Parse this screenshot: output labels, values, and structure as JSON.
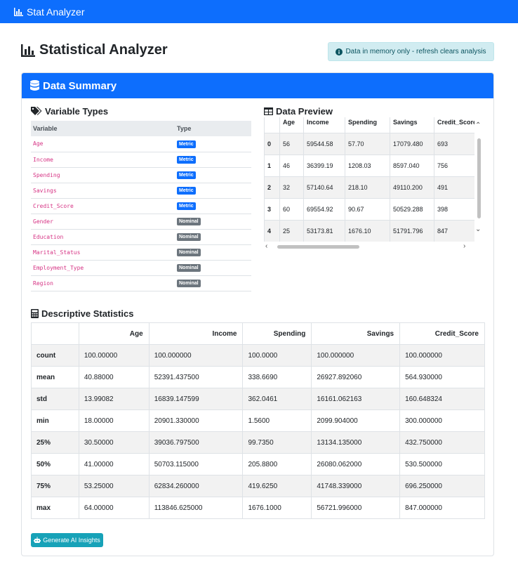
{
  "navbar": {
    "brand": "Stat Analyzer"
  },
  "header": {
    "title": "Statistical Analyzer",
    "alert": "Data in memory only - refresh clears analysis"
  },
  "card": {
    "title": "Data Summary"
  },
  "variable_types": {
    "title": "Variable Types",
    "headers": [
      "Variable",
      "Type"
    ],
    "rows": [
      {
        "name": "Age",
        "type": "Metric"
      },
      {
        "name": "Income",
        "type": "Metric"
      },
      {
        "name": "Spending",
        "type": "Metric"
      },
      {
        "name": "Savings",
        "type": "Metric"
      },
      {
        "name": "Credit_Score",
        "type": "Metric"
      },
      {
        "name": "Gender",
        "type": "Nominal"
      },
      {
        "name": "Education",
        "type": "Nominal"
      },
      {
        "name": "Marital_Status",
        "type": "Nominal"
      },
      {
        "name": "Employment_Type",
        "type": "Nominal"
      },
      {
        "name": "Region",
        "type": "Nominal"
      }
    ],
    "colors": {
      "Metric": "#0d6efd",
      "Nominal": "#6c757d"
    }
  },
  "data_preview": {
    "title": "Data Preview",
    "headers": [
      "",
      "Age",
      "Income",
      "Spending",
      "Savings",
      "Credit_Score"
    ],
    "rows": [
      [
        "0",
        "56",
        "59544.58",
        "57.70",
        "17079.480",
        "693"
      ],
      [
        "1",
        "46",
        "36399.19",
        "1208.03",
        "8597.040",
        "756"
      ],
      [
        "2",
        "32",
        "57140.64",
        "218.10",
        "49110.200",
        "491"
      ],
      [
        "3",
        "60",
        "69554.92",
        "90.67",
        "50529.288",
        "398"
      ],
      [
        "4",
        "25",
        "53173.81",
        "1676.10",
        "51791.796",
        "847"
      ]
    ]
  },
  "descriptive_stats": {
    "title": "Descriptive Statistics",
    "headers": [
      "",
      "Age",
      "Income",
      "Spending",
      "Savings",
      "Credit_Score"
    ],
    "rows": [
      [
        "count",
        "100.00000",
        "100.000000",
        "100.0000",
        "100.000000",
        "100.000000"
      ],
      [
        "mean",
        "40.88000",
        "52391.437500",
        "338.6690",
        "26927.892060",
        "564.930000"
      ],
      [
        "std",
        "13.99082",
        "16839.147599",
        "362.0461",
        "16161.062163",
        "160.648324"
      ],
      [
        "min",
        "18.00000",
        "20901.330000",
        "1.5600",
        "2099.904000",
        "300.000000"
      ],
      [
        "25%",
        "30.50000",
        "39036.797500",
        "99.7350",
        "13134.135000",
        "432.750000"
      ],
      [
        "50%",
        "41.00000",
        "50703.115000",
        "205.8800",
        "26080.062000",
        "530.500000"
      ],
      [
        "75%",
        "53.25000",
        "62834.260000",
        "419.6250",
        "41748.339000",
        "696.250000"
      ],
      [
        "max",
        "64.00000",
        "113846.625000",
        "1676.1000",
        "56721.996000",
        "847.000000"
      ]
    ]
  },
  "ai_button": {
    "label": "Generate AI Insights"
  },
  "colors": {
    "primary": "#0d6efd",
    "info_alert_bg": "#d1ecf1",
    "info_alert_text": "#0c5460",
    "ai_button": "#17a2b8"
  }
}
